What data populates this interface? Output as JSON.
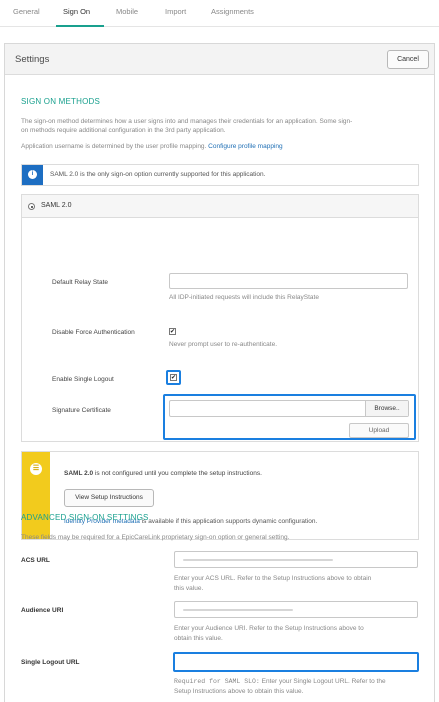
{
  "tabs": [
    "General",
    "Sign On",
    "Mobile",
    "Import",
    "Assignments"
  ],
  "panel": {
    "title": "Settings",
    "cancel_label": "Cancel"
  },
  "sign_on": {
    "heading": "SIGN ON METHODS",
    "desc_line1": "The sign-on method determines how a user signs into and manages their credentials for an application. Some sign-",
    "desc_line2": "on methods require additional configuration in the 3rd party application.",
    "username_text": "Application username is determined by the user profile mapping.",
    "username_link": "Configure profile mapping",
    "info_text": "SAML 2.0 is the only sign-on option currently supported for this application."
  },
  "saml": {
    "option_label": "SAML 2.0",
    "relay_label": "Default Relay State",
    "relay_value": "",
    "relay_hint": "All IDP-initiated requests will include this RelayState",
    "force_label": "Disable Force Authentication",
    "force_checked": true,
    "force_hint": "Never prompt user to re-authenticate.",
    "slo_label": "Enable Single Logout",
    "slo_checked": true,
    "cert_label": "Signature Certificate",
    "cert_value": "",
    "browse_label": "Browse..",
    "upload_label": "Upload"
  },
  "warning": {
    "saml_bold": "SAML 2.0",
    "text": "is not configured until you complete the setup instructions.",
    "button_label": "View Setup Instructions",
    "meta_link": "Identity Provider metadata",
    "meta_text": "is available if this application supports dynamic configuration."
  },
  "advanced": {
    "heading": "ADVANCED SIGN-ON SETTINGS",
    "desc": "These fields may be required for a EpicCareLink proprietary sign-on option or general setting.",
    "acs_label": "ACS URL",
    "acs_hint1": "Enter your ACS URL. Refer to the Setup Instructions above to obtain",
    "acs_hint2": "this value.",
    "aud_label": "Audience URI",
    "aud_hint1": "Enter your Audience URI. Refer to the Setup Instructions above to",
    "aud_hint2": "obtain this value.",
    "slo_url_label": "Single Logout URL",
    "slo_url_value": "",
    "slo_hint_mono": "Required for SAML SLO:",
    "slo_hint1": "Enter your Single Logout URL. Refer to the",
    "slo_hint2": "Setup Instructions above to obtain this value."
  },
  "colors": {
    "accent": "#19a08e",
    "link": "#1f6fb5",
    "highlight": "#1a7fe0",
    "info": "#1d6ec2",
    "warning": "#f2cb1d"
  }
}
